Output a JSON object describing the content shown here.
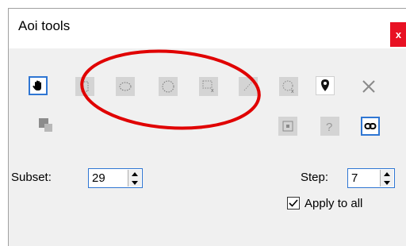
{
  "window": {
    "title": "Aoi tools",
    "close_label": "x"
  },
  "toolbar": {
    "row1": [
      "pan-tool",
      "rect-select-tool",
      "ellipse-select-tool",
      "circle-select-tool",
      "rect-exclude-tool",
      "line-exclude-tool",
      "circle-exclude-tool",
      "pin-tool",
      "delete-tool"
    ],
    "row2": [
      "copy-tool",
      "center-tool",
      "help-tool",
      "link-tool"
    ]
  },
  "subset": {
    "label": "Subset:",
    "value": "29"
  },
  "step": {
    "label": "Step:",
    "value": "7"
  },
  "apply_to_all": {
    "label": "Apply to all",
    "checked": true
  },
  "annotation": {
    "color": "#e00000",
    "shape": "ellipse"
  },
  "colors": {
    "accent": "#2f76d3",
    "close": "#e81123"
  }
}
